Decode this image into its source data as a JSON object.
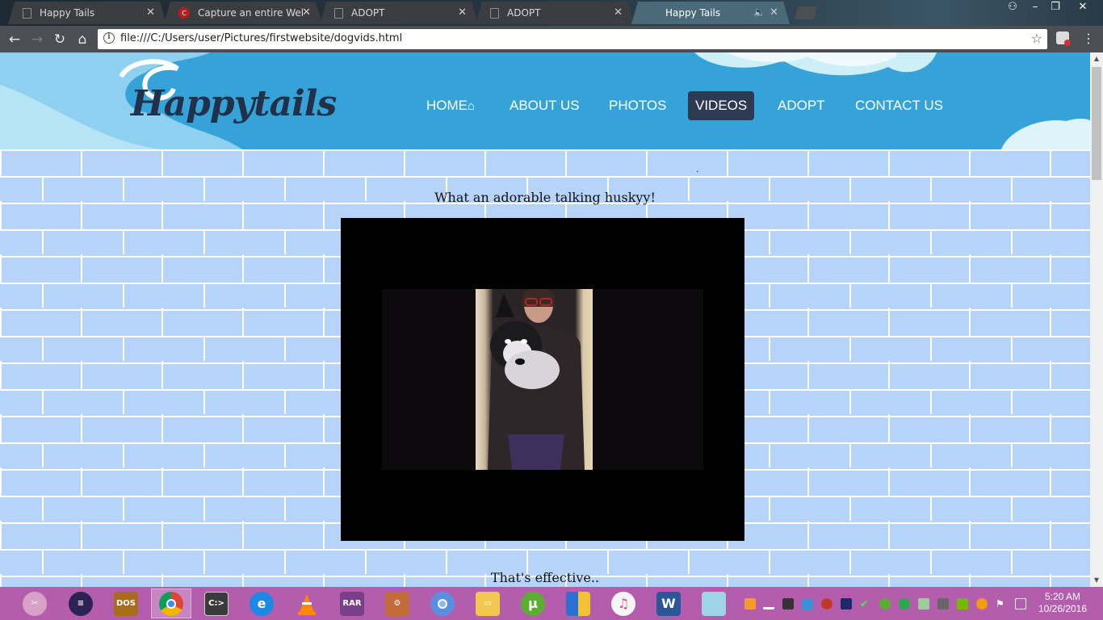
{
  "browser": {
    "tabs": [
      {
        "title": "Happy Tails",
        "icon": "page-icon",
        "active": false
      },
      {
        "title": "Capture an entire Web p",
        "icon": "capture-logo-icon",
        "active": false
      },
      {
        "title": "ADOPT",
        "icon": "page-icon",
        "active": false
      },
      {
        "title": "ADOPT",
        "icon": "page-icon",
        "active": false
      },
      {
        "title": "Happy Tails",
        "icon": "none",
        "active": true
      }
    ],
    "url": "file:///C:/Users/user/Pictures/firstwebsite/dogvids.html"
  },
  "site": {
    "logo": "Happytails",
    "nav": [
      {
        "label": "HOME",
        "icon": "home-icon"
      },
      {
        "label": "ABOUT US"
      },
      {
        "label": "PHOTOS"
      },
      {
        "label": "VIDEOS",
        "active": true
      },
      {
        "label": "ADOPT"
      },
      {
        "label": "CONTACT US"
      }
    ],
    "dot": ".",
    "caption1": "What an adorable talking huskyy!",
    "caption2": "That's effective.."
  },
  "taskbar": {
    "apps": [
      "scissors-icon",
      "eclipse-icon",
      "dosbox-icon",
      "chrome-icon",
      "cmd-icon",
      "ie-icon",
      "vlc-icon",
      "winrar-icon",
      "app-icon",
      "chrome-canary-icon",
      "file-explorer-icon",
      "utorrent-icon",
      "shield-icon",
      "itunes-icon",
      "word-icon",
      "notepad-icon"
    ],
    "time": "5:20 AM",
    "date": "10/26/2016"
  },
  "colors": {
    "header": "#35a3d8",
    "brick": "#b6d3fa",
    "nav_active": "#2d3a52",
    "taskbar": "#b45dac"
  }
}
